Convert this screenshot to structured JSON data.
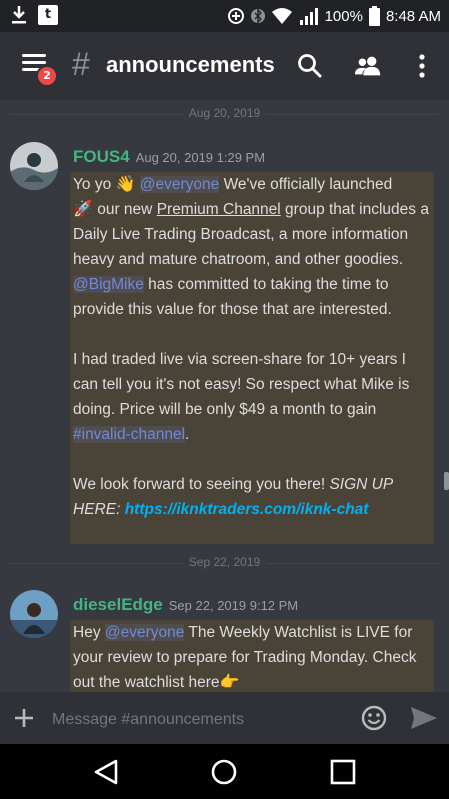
{
  "status_bar": {
    "battery": "100%",
    "time": "8:48 AM",
    "notif_letter": "t"
  },
  "header": {
    "badge_count": "2",
    "hash": "#",
    "channel": "announcements"
  },
  "date_dividers": [
    "Aug 20, 2019",
    "Sep 22, 2019"
  ],
  "messages": [
    {
      "author": "FOUS4",
      "timestamp": "Aug 20, 2019 1:29 PM",
      "p1_a": "Yo yo ",
      "p1_wave": "👋",
      "p1_mention1": "@everyone",
      "p1_b": " We've officially launched",
      "p1_rocket": "🚀",
      "p1_c": " our new ",
      "p1_link": "Premium Channel",
      "p1_d": " group that includes a Daily Live Trading Broadcast, a more information heavy and mature chatroom, and other goodies. ",
      "p1_mention2": "@BigMike",
      "p1_e": " has committed to taking the time to provide this value for those that are interested.",
      "p2_a": "I had traded live via screen-share for 10+ years I can tell you it's not easy!  So respect what Mike is doing. Price will be only $49 a month to gain ",
      "p2_channel": "#invalid-channel",
      "p2_b": ".",
      "p3_a": "We look forward to seeing you there! ",
      "p3_signup": "SIGN UP HERE: ",
      "p3_url": "https://iknktraders.com/iknk-chat"
    },
    {
      "author": "dieselEdge",
      "timestamp": "Sep 22, 2019 9:12 PM",
      "text_a": "Hey ",
      "mention": "@everyone",
      "text_b": " The Weekly Watchlist is LIVE for your review to prepare for Trading Monday. Check out the watchlist here",
      "emoji": "👉"
    }
  ],
  "input": {
    "placeholder": "Message #announcements"
  },
  "colors": {
    "accent_green": "#43b581",
    "mention": "#7289da",
    "highlight": "#4a4438",
    "link": "#00b0f4"
  }
}
